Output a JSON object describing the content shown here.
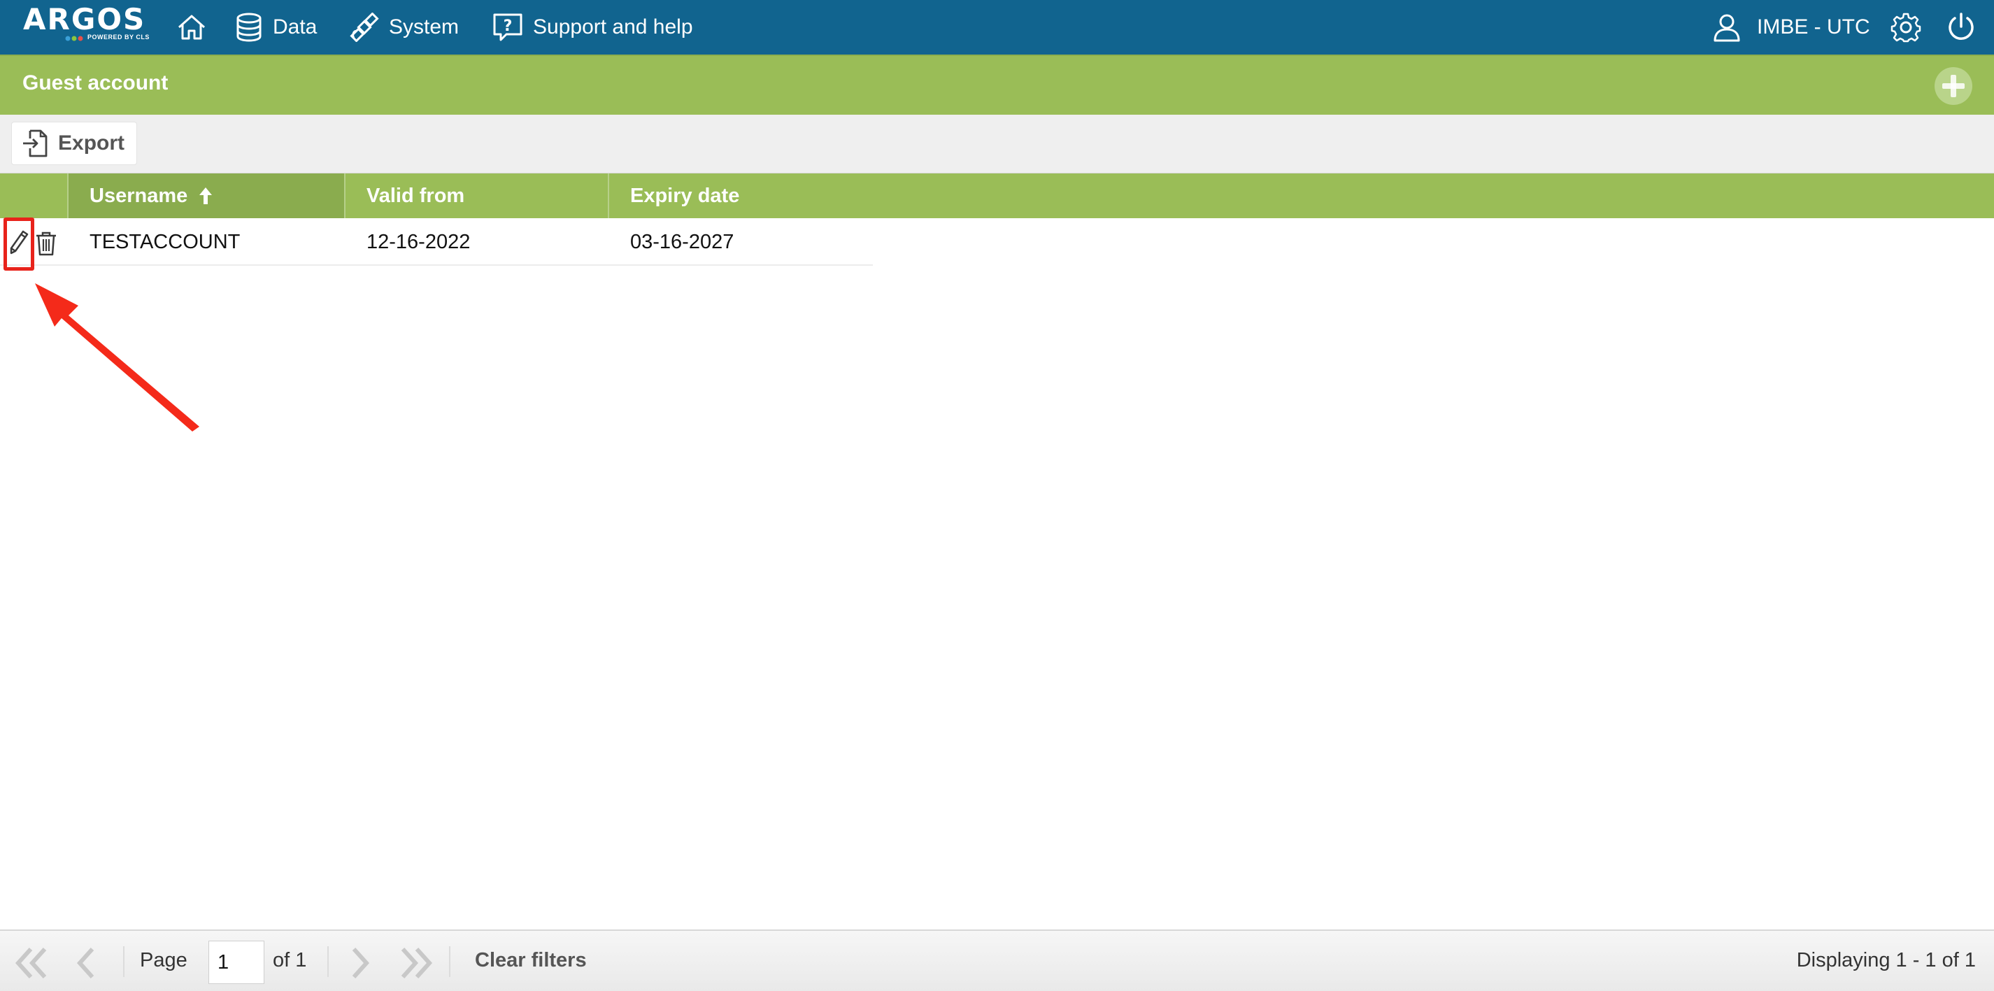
{
  "app": {
    "logo_text": "ARGOS",
    "logo_sub": "POWERED BY CLS"
  },
  "nav": {
    "items": [
      {
        "label": "Data",
        "icon": "database-icon"
      },
      {
        "label": "System",
        "icon": "satellite-icon"
      },
      {
        "label": "Support and help",
        "icon": "help-icon"
      }
    ],
    "user": "IMBE - UTC"
  },
  "section": {
    "title": "Guest account"
  },
  "toolbar": {
    "export_label": "Export"
  },
  "grid": {
    "columns": [
      {
        "label": "Username",
        "sorted": "ascending"
      },
      {
        "label": "Valid from"
      },
      {
        "label": "Expiry date"
      }
    ],
    "rows": [
      {
        "username": "TESTACCOUNT",
        "valid_from": "12-16-2022",
        "expiry_date": "03-16-2027"
      }
    ]
  },
  "pager": {
    "page_label": "Page",
    "page_value": "1",
    "of_label": "of 1",
    "clear_filters": "Clear filters",
    "displaying": "Displaying 1 - 1 of 1"
  },
  "colors": {
    "topbar": "#11648f",
    "accent_green": "#9abd57",
    "annotation_red": "#e8231b"
  }
}
